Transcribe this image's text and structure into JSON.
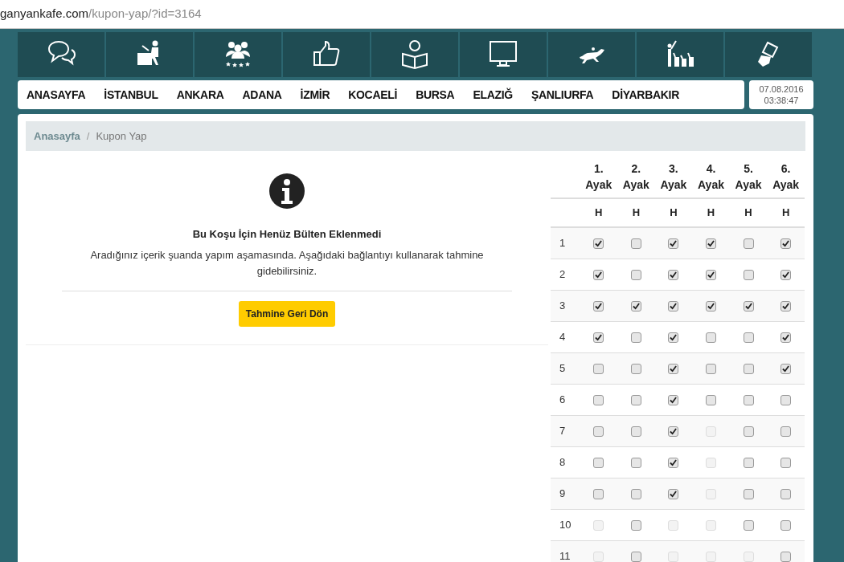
{
  "address_bar": {
    "domain": "ganyankafe.com",
    "path": "/kupon-yap/?id=3164"
  },
  "nav": {
    "items": [
      "ANASAYFA",
      "İSTANBUL",
      "ANKARA",
      "ADANA",
      "İZMİR",
      "KOCAELİ",
      "BURSA",
      "ELAZIĞ",
      "ŞANLIURFA",
      "DİYARBAKIR"
    ],
    "date": "07.08.2016",
    "time": "03:38:47"
  },
  "breadcrumb": {
    "items": [
      "Anasayfa",
      "Kupon Yap"
    ],
    "separator": "/"
  },
  "notice": {
    "title": "Bu Koşu İçin Henüz Bülten Eklenmedi",
    "message": "Aradığınız içerik şuanda yapım aşamasında. Aşağıdaki bağlantıyı kullanarak tahmine gidebilirsiniz.",
    "button": "Tahmine Geri Dön"
  },
  "table": {
    "columns": [
      "1. Ayak",
      "2. Ayak",
      "3. Ayak",
      "4. Ayak",
      "5. Ayak",
      "6. Ayak"
    ],
    "subheaders": [
      "H",
      "H",
      "H",
      "H",
      "H",
      "H"
    ],
    "rows": [
      {
        "label": "1",
        "cells": [
          {
            "checked": true,
            "disabled": false
          },
          {
            "checked": false,
            "disabled": false
          },
          {
            "checked": true,
            "disabled": false
          },
          {
            "checked": true,
            "disabled": false
          },
          {
            "checked": false,
            "disabled": false
          },
          {
            "checked": true,
            "disabled": false
          }
        ]
      },
      {
        "label": "2",
        "cells": [
          {
            "checked": true,
            "disabled": false
          },
          {
            "checked": false,
            "disabled": false
          },
          {
            "checked": true,
            "disabled": false
          },
          {
            "checked": true,
            "disabled": false
          },
          {
            "checked": false,
            "disabled": false
          },
          {
            "checked": true,
            "disabled": false
          }
        ]
      },
      {
        "label": "3",
        "cells": [
          {
            "checked": true,
            "disabled": false
          },
          {
            "checked": true,
            "disabled": false
          },
          {
            "checked": true,
            "disabled": false
          },
          {
            "checked": true,
            "disabled": false
          },
          {
            "checked": true,
            "disabled": false
          },
          {
            "checked": true,
            "disabled": false
          }
        ]
      },
      {
        "label": "4",
        "cells": [
          {
            "checked": true,
            "disabled": false
          },
          {
            "checked": false,
            "disabled": false
          },
          {
            "checked": true,
            "disabled": false
          },
          {
            "checked": false,
            "disabled": false
          },
          {
            "checked": false,
            "disabled": false
          },
          {
            "checked": true,
            "disabled": false
          }
        ]
      },
      {
        "label": "5",
        "cells": [
          {
            "checked": false,
            "disabled": false
          },
          {
            "checked": false,
            "disabled": false
          },
          {
            "checked": true,
            "disabled": false
          },
          {
            "checked": false,
            "disabled": false
          },
          {
            "checked": false,
            "disabled": false
          },
          {
            "checked": true,
            "disabled": false
          }
        ]
      },
      {
        "label": "6",
        "cells": [
          {
            "checked": false,
            "disabled": false
          },
          {
            "checked": false,
            "disabled": false
          },
          {
            "checked": true,
            "disabled": false
          },
          {
            "checked": false,
            "disabled": false
          },
          {
            "checked": false,
            "disabled": false
          },
          {
            "checked": false,
            "disabled": false
          }
        ]
      },
      {
        "label": "7",
        "cells": [
          {
            "checked": false,
            "disabled": false
          },
          {
            "checked": false,
            "disabled": false
          },
          {
            "checked": true,
            "disabled": false
          },
          {
            "checked": false,
            "disabled": true
          },
          {
            "checked": false,
            "disabled": false
          },
          {
            "checked": false,
            "disabled": false
          }
        ]
      },
      {
        "label": "8",
        "cells": [
          {
            "checked": false,
            "disabled": false
          },
          {
            "checked": false,
            "disabled": false
          },
          {
            "checked": true,
            "disabled": false
          },
          {
            "checked": false,
            "disabled": true
          },
          {
            "checked": false,
            "disabled": false
          },
          {
            "checked": false,
            "disabled": false
          }
        ]
      },
      {
        "label": "9",
        "cells": [
          {
            "checked": false,
            "disabled": false
          },
          {
            "checked": false,
            "disabled": false
          },
          {
            "checked": true,
            "disabled": false
          },
          {
            "checked": false,
            "disabled": true
          },
          {
            "checked": false,
            "disabled": false
          },
          {
            "checked": false,
            "disabled": false
          }
        ]
      },
      {
        "label": "10",
        "cells": [
          {
            "checked": false,
            "disabled": true
          },
          {
            "checked": false,
            "disabled": false
          },
          {
            "checked": false,
            "disabled": true
          },
          {
            "checked": false,
            "disabled": true
          },
          {
            "checked": false,
            "disabled": false
          },
          {
            "checked": false,
            "disabled": false
          }
        ]
      },
      {
        "label": "11",
        "cells": [
          {
            "checked": false,
            "disabled": true
          },
          {
            "checked": false,
            "disabled": false
          },
          {
            "checked": false,
            "disabled": true
          },
          {
            "checked": false,
            "disabled": true
          },
          {
            "checked": false,
            "disabled": true
          },
          {
            "checked": false,
            "disabled": false
          }
        ]
      }
    ]
  }
}
